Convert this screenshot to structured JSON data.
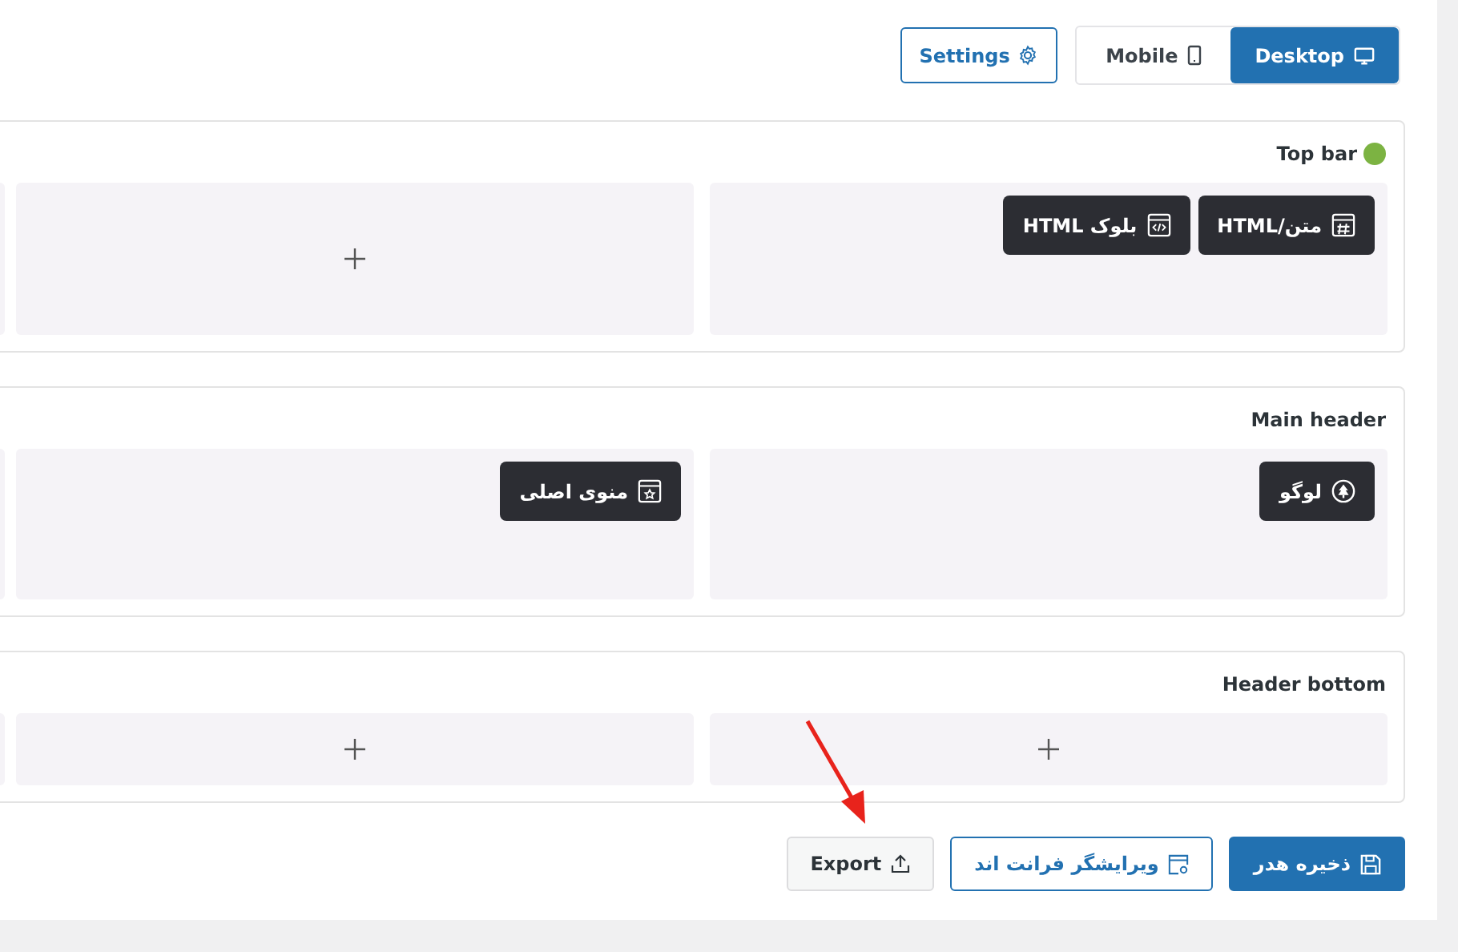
{
  "toolbar": {
    "settings_button": "Settings",
    "view_tabs": [
      {
        "label": "Desktop",
        "kind": "desktop",
        "selected": true
      },
      {
        "label": "Mobile",
        "kind": "mobile",
        "selected": false
      }
    ]
  },
  "sections": [
    {
      "title": "Top bar",
      "color": "#7cb342",
      "slots": [
        {
          "kind": "elements",
          "items": [
            {
              "label": "متن/HTML",
              "kind": "text"
            },
            {
              "label": "بلوک HTML",
              "kind": "html"
            }
          ]
        },
        {
          "kind": "empty"
        }
      ]
    },
    {
      "title": "Main header",
      "slots": [
        {
          "kind": "elements",
          "items": [
            {
              "label": "لوگو",
              "kind": "logo"
            }
          ]
        },
        {
          "kind": "elements",
          "items": [
            {
              "label": "منوی اصلی",
              "kind": "menu"
            }
          ]
        }
      ]
    },
    {
      "title": "Header bottom",
      "slots": [
        {
          "kind": "empty"
        },
        {
          "kind": "empty"
        }
      ]
    }
  ],
  "footer_buttons": [
    {
      "label": "ذخیره هدر",
      "kind": "save"
    },
    {
      "label": "ویرایشگر فرانت اند",
      "kind": "editor"
    },
    {
      "label": "Export",
      "kind": "export"
    }
  ]
}
